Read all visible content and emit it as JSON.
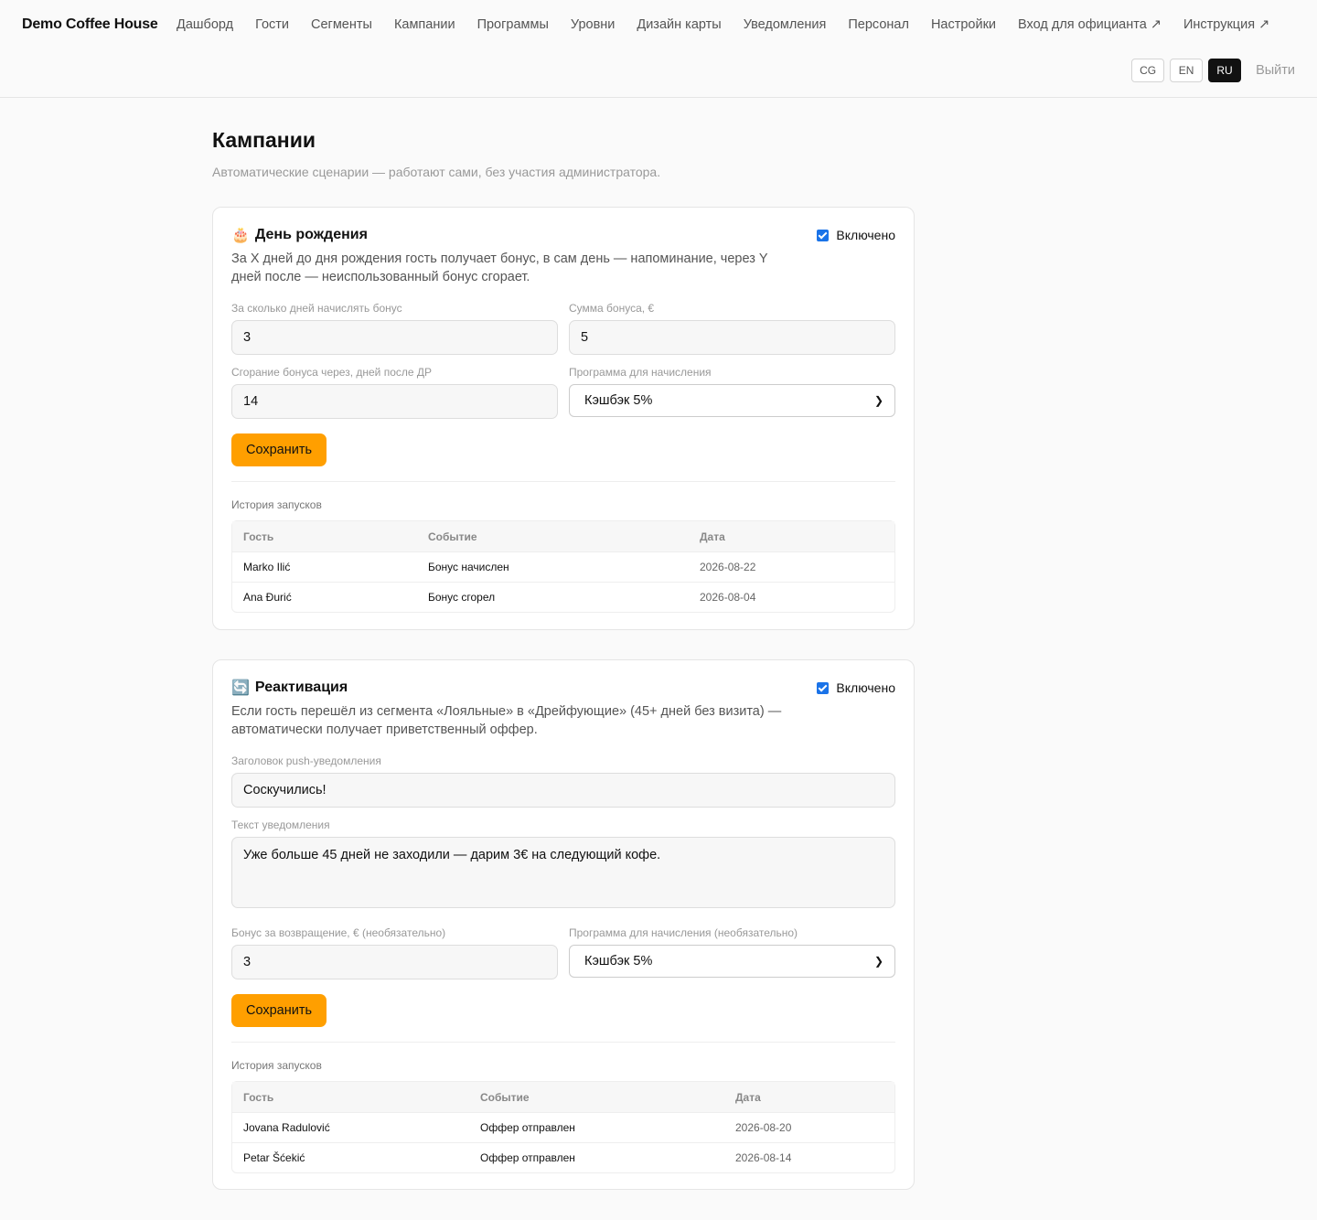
{
  "header": {
    "brand": "Demo Coffee House",
    "nav": [
      "Дашборд",
      "Гости",
      "Сегменты",
      "Кампании",
      "Программы",
      "Уровни",
      "Дизайн карты",
      "Уведомления",
      "Персонал",
      "Настройки",
      "Вход для официанта ↗",
      "Инструкция ↗"
    ],
    "languages": [
      "CG",
      "EN",
      "RU"
    ],
    "active_language": "RU",
    "logout_label": "Выйти"
  },
  "page": {
    "title": "Кампании",
    "subtitle": "Автоматические сценарии — работают сами, без участия администратора."
  },
  "birthday": {
    "icon": "🎂",
    "title": "День рождения",
    "enabled_label": "Включено",
    "description": "За X дней до дня рождения гость получает бонус, в сам день — напоминание, через Y дней после — неиспользованный бонус сгорает.",
    "days_before_label": "За сколько дней начислять бонус",
    "days_before_value": "3",
    "bonus_label": "Сумма бонуса, €",
    "bonus_value": "5",
    "expire_label": "Сгорание бонуса через, дней после ДР",
    "expire_value": "14",
    "program_label": "Программа для начисления",
    "program_value": "Кэшбэк 5%",
    "save_label": "Сохранить",
    "history_label": "История запусков",
    "history_headers": [
      "Гость",
      "Событие",
      "Дата"
    ],
    "history_rows": [
      [
        "Marko Ilić",
        "Бонус начислен",
        "2026-08-22"
      ],
      [
        "Ana Đurić",
        "Бонус сгорел",
        "2026-08-04"
      ]
    ]
  },
  "reactivation": {
    "icon": "🔄",
    "title": "Реактивация",
    "enabled_label": "Включено",
    "description": "Если гость перешёл из сегмента «Лояльные» в «Дрейфующие» (45+ дней без визита) — автоматически получает приветственный оффер.",
    "push_title_label": "Заголовок push-уведомления",
    "push_title_value": "Соскучились!",
    "push_text_label": "Текст уведомления",
    "push_text_value": "Уже больше 45 дней не заходили — дарим 3€ на следующий кофе.",
    "bonus_label": "Бонус за возвращение, € (необязательно)",
    "bonus_value": "3",
    "program_label": "Программа для начисления (необязательно)",
    "program_value": "Кэшбэк 5%",
    "save_label": "Сохранить",
    "history_label": "История запусков",
    "history_headers": [
      "Гость",
      "Событие",
      "Дата"
    ],
    "history_rows": [
      [
        "Jovana Radulović",
        "Оффер отправлен",
        "2026-08-20"
      ],
      [
        "Petar Šćekić",
        "Оффер отправлен",
        "2026-08-14"
      ]
    ]
  }
}
